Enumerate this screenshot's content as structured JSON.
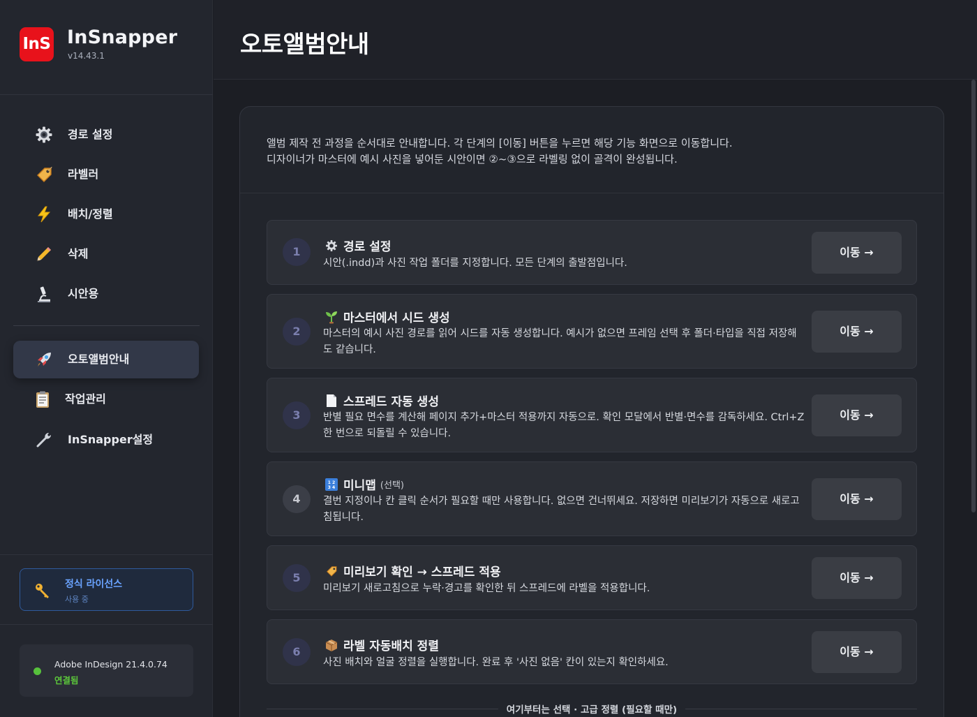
{
  "app": {
    "logo_text": "InS",
    "name": "InSnapper",
    "version": "v14.43.1"
  },
  "sidebar": {
    "items": [
      {
        "label": "경로 설정",
        "icon": "gear-icon"
      },
      {
        "label": "라벨러",
        "icon": "tag-icon"
      },
      {
        "label": "배치/정렬",
        "icon": "lightning-icon"
      },
      {
        "label": "삭제",
        "icon": "pencil-icon"
      },
      {
        "label": "시안용",
        "icon": "microscope-icon"
      },
      {
        "label": "오토앨범안내",
        "icon": "rocket-icon",
        "active": true
      },
      {
        "label": "작업관리",
        "icon": "clipboard-icon"
      },
      {
        "label": "InSnapper설정",
        "icon": "wrench-icon"
      }
    ],
    "license": {
      "title": "정식 라이선스",
      "subtitle": "사용 중",
      "icon": "key-icon"
    },
    "connection": {
      "app": "Adobe InDesign 21.4.0.74",
      "status": "연결됨",
      "status_color": "#5cc73b"
    }
  },
  "header": {
    "title": "오토앨범안내"
  },
  "intro": {
    "line1": "앨범 제작 전 과정을 순서대로 안내합니다. 각 단계의 [이동] 버튼을 누르면 해당 기능 화면으로 이동합니다.",
    "line2": "디자이너가 마스터에 예시 사진을 넣어둔 시안이면 ②~③으로 라벨링 없이 골격이 완성됩니다."
  },
  "steps": [
    {
      "num": "1",
      "icon": "gear-icon",
      "title": "경로 설정",
      "desc": "시안(.indd)과 사진 작업 폴더를 지정합니다. 모든 단계의 출발점입니다.",
      "button": "이동 →"
    },
    {
      "num": "2",
      "icon": "seedling-icon",
      "title": "마스터에서 시드 생성",
      "desc": "마스터의 예시 사진 경로를 읽어 시드를 자동 생성합니다. 예시가 없으면 프레임 선택 후 폴더·타입을 직접 저장해도 같습니다.",
      "button": "이동 →"
    },
    {
      "num": "3",
      "icon": "page-icon",
      "title": "스프레드 자동 생성",
      "desc": "반별 필요 면수를 계산해 페이지 추가+마스터 적용까지 자동으로. 확인 모달에서 반별·면수를 감독하세요. Ctrl+Z 한 번으로 되돌릴 수 있습니다.",
      "button": "이동 →"
    },
    {
      "num": "4",
      "icon": "numbers-icon",
      "title": "미니맵",
      "optional": "(선택)",
      "desc": "결번 지정이나 칸 클릭 순서가 필요할 때만 사용합니다. 없으면 건너뛰세요. 저장하면 미리보기가 자동으로 새로고침됩니다.",
      "button": "이동 →"
    },
    {
      "num": "5",
      "icon": "tag-icon",
      "title": "미리보기 확인 → 스프레드 적용",
      "desc": "미리보기 새로고침으로 누락·경고를 확인한 뒤 스프레드에 라벨을 적용합니다.",
      "button": "이동 →"
    },
    {
      "num": "6",
      "icon": "box-icon",
      "title": "라벨 자동배치 정렬",
      "desc": "사진 배치와 얼굴 정렬을 실행합니다. 완료 후 '사진 없음' 칸이 있는지 확인하세요.",
      "button": "이동 →"
    }
  ],
  "optional_section": {
    "label": "여기부터는 선택 · 고급 정렬 (필요할 때만)"
  }
}
